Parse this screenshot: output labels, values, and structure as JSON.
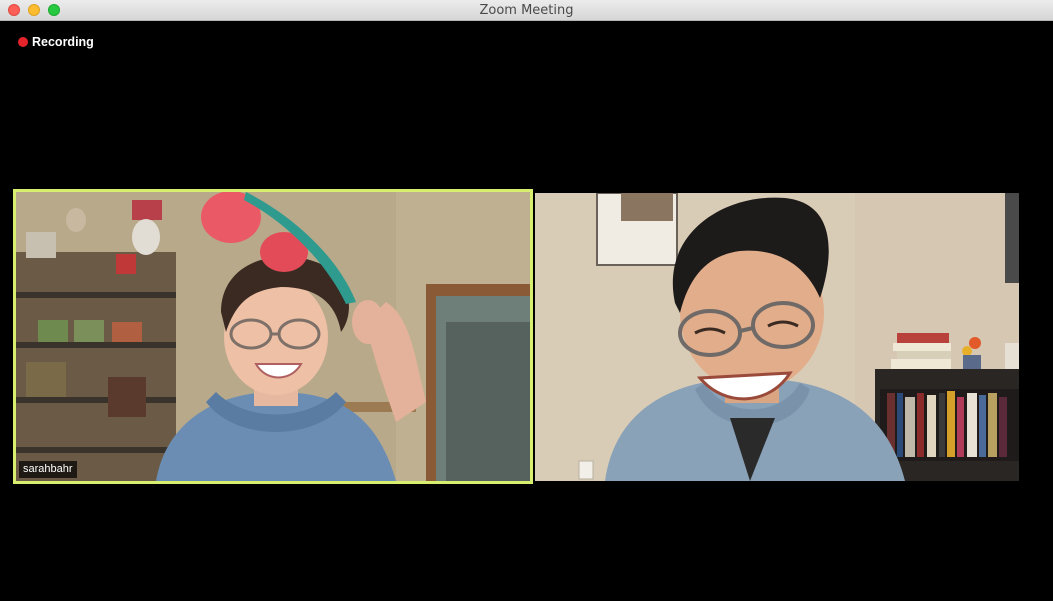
{
  "window": {
    "title": "Zoom Meeting"
  },
  "recording": {
    "label": "Recording",
    "status_color": "#e5232a"
  },
  "participants": [
    {
      "name": "sarahbahr",
      "active_speaker": true,
      "highlight_color": "#d7ee6e"
    },
    {
      "name": "",
      "active_speaker": false
    }
  ],
  "colors": {
    "background": "#000000",
    "titlebar": "#e0e0e0"
  }
}
